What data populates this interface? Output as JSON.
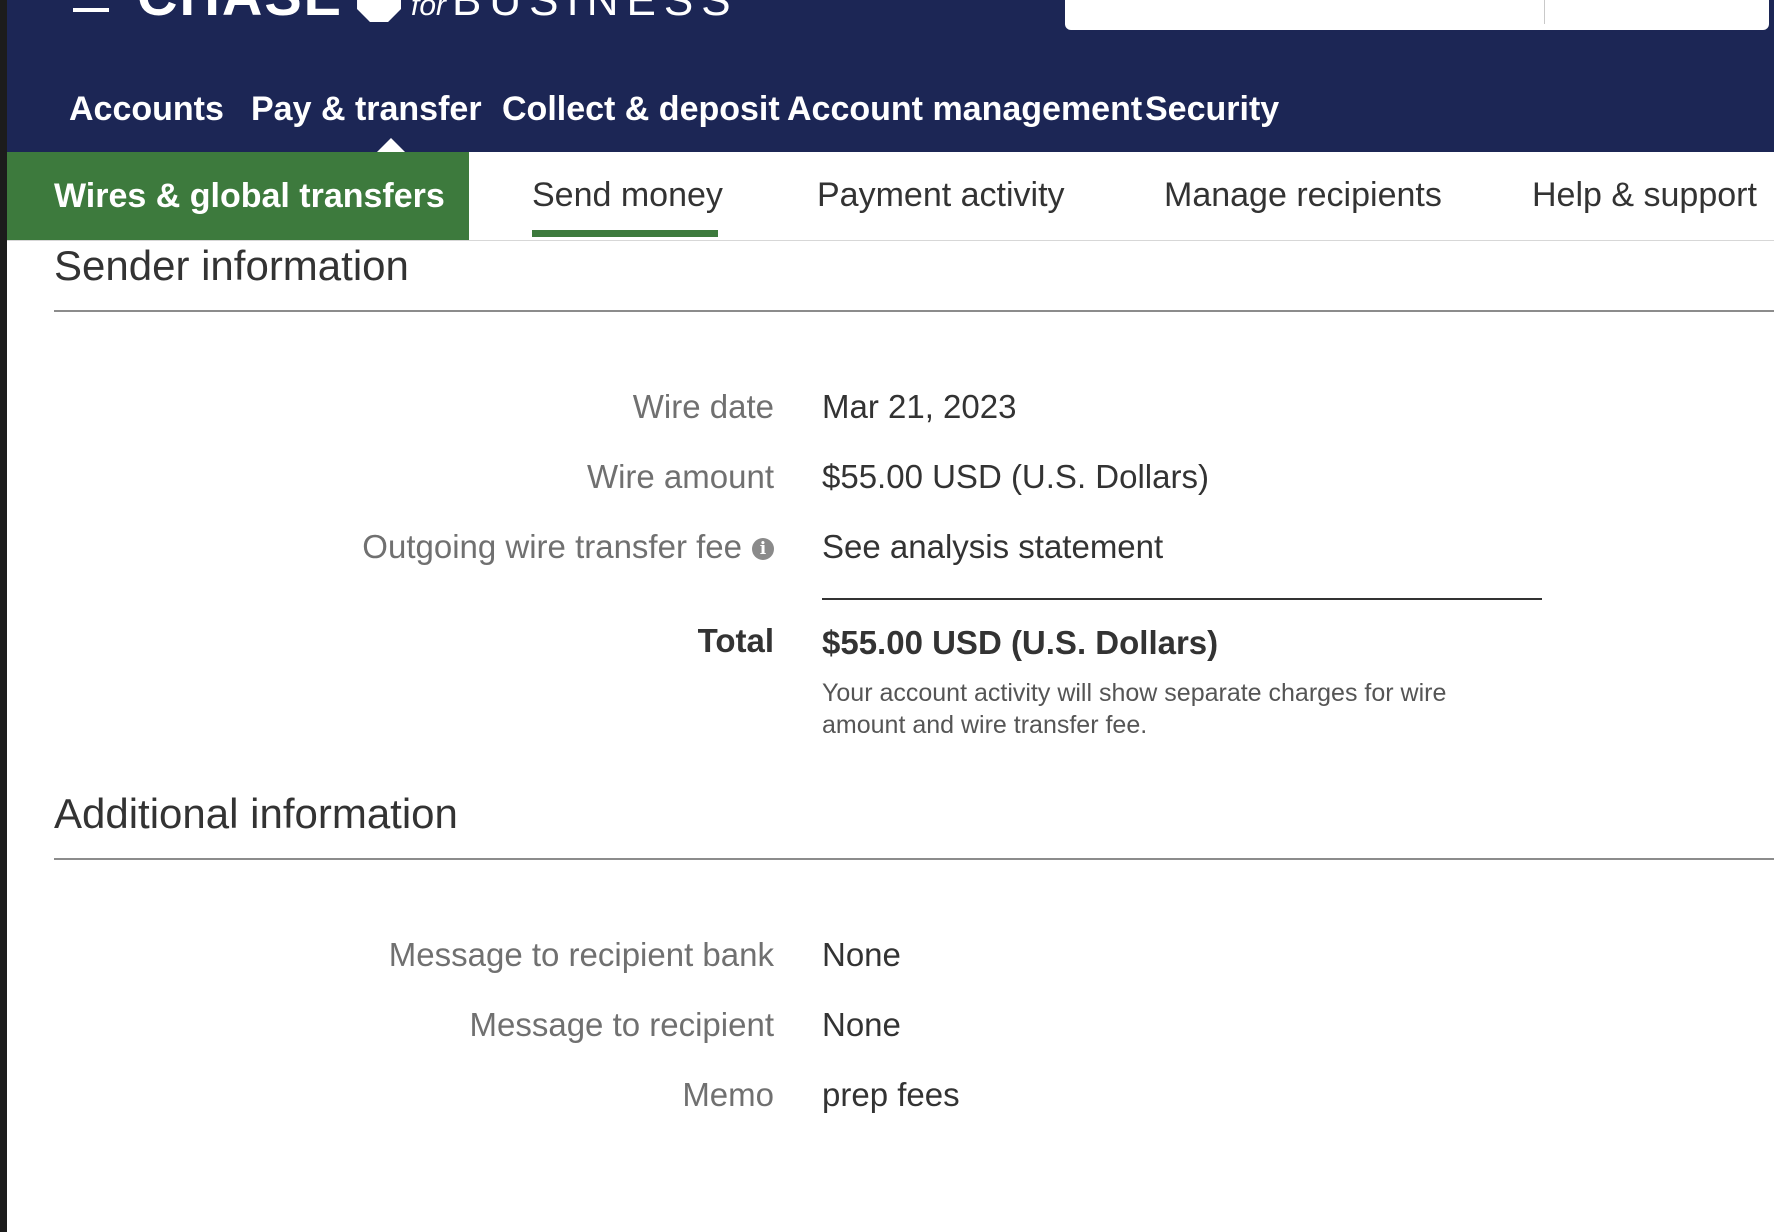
{
  "brand": {
    "name": "CHASE",
    "for": "for",
    "business": "BUSINESS"
  },
  "main_nav": {
    "items": [
      "Accounts",
      "Pay & transfer",
      "Collect & deposit",
      "Account management",
      "Security"
    ],
    "active": "Pay & transfer"
  },
  "sub_nav": {
    "section": "Wires & global transfers",
    "items": [
      "Send money",
      "Payment activity",
      "Manage recipients",
      "Help & support"
    ],
    "active": "Send money"
  },
  "sender_section": {
    "title": "Sender information",
    "wire_date_label": "Wire date",
    "wire_date_value": "Mar 21, 2023",
    "wire_amount_label": "Wire amount",
    "wire_amount_value": "$55.00 USD (U.S. Dollars)",
    "fee_label": "Outgoing wire transfer fee",
    "fee_value": "See analysis statement",
    "total_label": "Total",
    "total_value": "$55.00  USD (U.S. Dollars)",
    "total_note": "Your account activity will show separate charges for wire amount and wire transfer fee."
  },
  "additional_section": {
    "title": "Additional information",
    "bank_message_label": "Message to recipient bank",
    "bank_message_value": "None",
    "recipient_message_label": "Message to recipient",
    "recipient_message_value": "None",
    "memo_label": "Memo",
    "memo_value": "prep fees"
  },
  "colors": {
    "header_bg": "#1c2655",
    "accent_green": "#3d7a3d"
  }
}
